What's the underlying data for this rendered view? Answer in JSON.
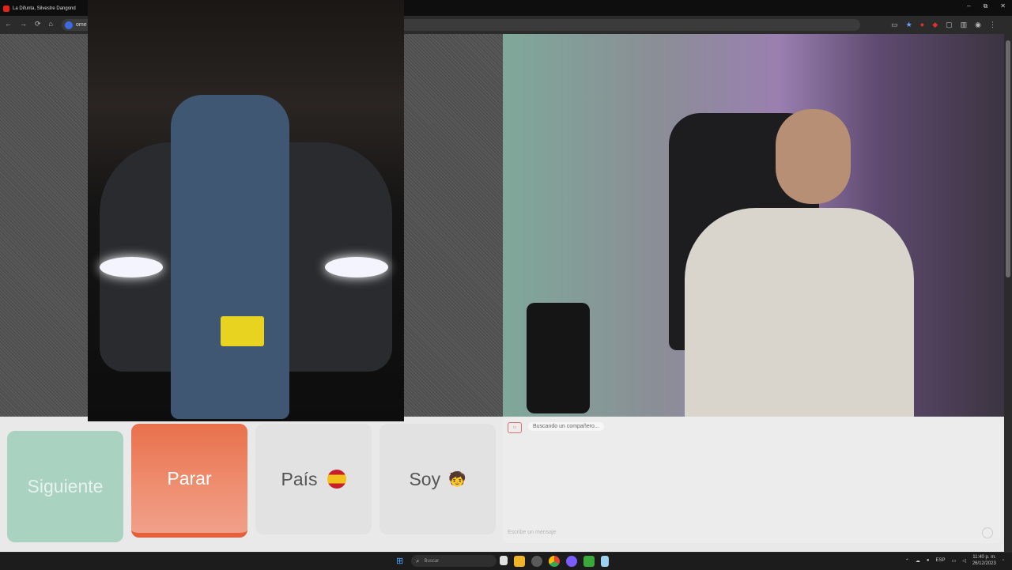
{
  "browser": {
    "tab_title": "La Difunta, Silvestre Dangond",
    "url": "ome",
    "window_controls": [
      "–",
      "⧉",
      "✕"
    ],
    "nav_icons": [
      "←",
      "→",
      "⟳",
      "⌂"
    ]
  },
  "chat": {
    "status": "Buscando un compañero...",
    "input_placeholder": "Escribe un mensaje"
  },
  "controls": {
    "next_label": "Siguiente",
    "stop_label": "Parar",
    "country_label": "País",
    "soy_label": "Soy",
    "soy_emoji": "🧒"
  },
  "taskbar": {
    "search_placeholder": "Buscar",
    "language": "ESP",
    "time": "11:40 p. m.",
    "date": "26/12/2023"
  },
  "colors": {
    "next": "#a9d2c0",
    "stop": "#e8714b",
    "neutral": "#e2e2e2"
  }
}
